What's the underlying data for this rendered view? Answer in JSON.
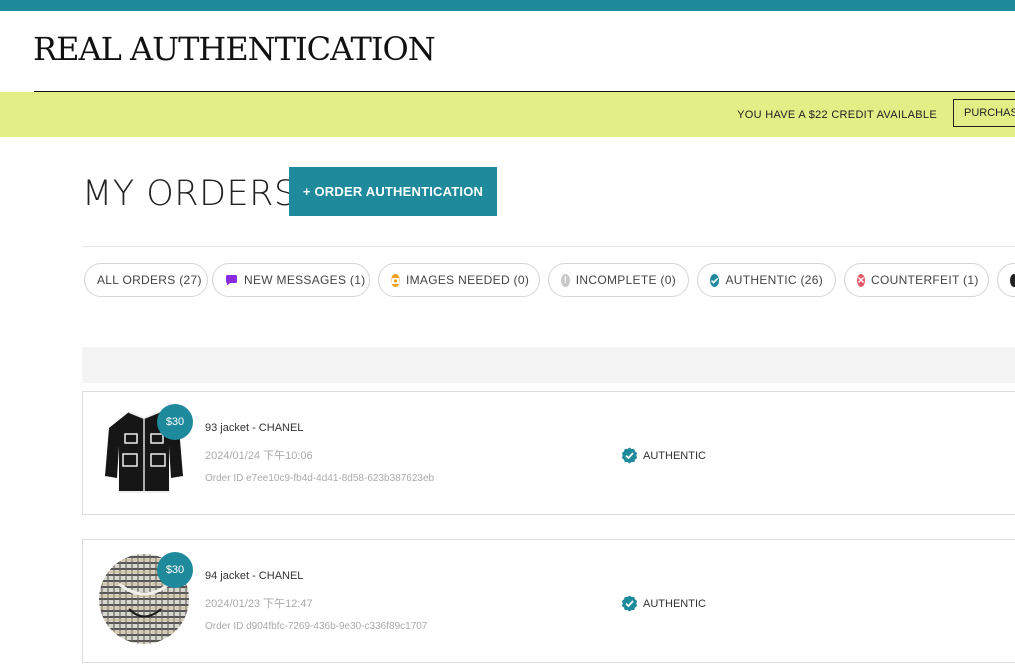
{
  "header": {
    "brand": "REAL AUTHENTICATION"
  },
  "credit": {
    "text": "YOU HAVE A $22 CREDIT AVAILABLE",
    "button_label": "PURCHASE"
  },
  "page": {
    "title": "MY ORDERS",
    "order_button_label": "+ ORDER AUTHENTICATION"
  },
  "filters": [
    {
      "label": "ALL ORDERS (27)",
      "icon": "none"
    },
    {
      "label": "NEW MESSAGES (1)",
      "icon": "chat-bubble-icon",
      "color": "#8a2be2"
    },
    {
      "label": "IMAGES NEEDED (0)",
      "icon": "camera-icon",
      "color": "#f0a020"
    },
    {
      "label": "INCOMPLETE (0)",
      "icon": "exclamation-icon",
      "color": "#c8c8c8"
    },
    {
      "label": "AUTHENTIC (26)",
      "icon": "verified-check-icon",
      "color": "#1f8a9c"
    },
    {
      "label": "COUNTERFEIT (1)",
      "icon": "x-circle-icon",
      "color": "#e05a6a"
    }
  ],
  "orders": [
    {
      "price": "$30",
      "name": "93 jacket - CHANEL",
      "date": "2024/01/24 下午10:06",
      "order_id": "Order ID e7ee10c9-fb4d-4d41-8d58-623b387623eb",
      "status": "AUTHENTIC"
    },
    {
      "price": "$30",
      "name": "94 jacket - CHANEL",
      "date": "2024/01/23 下午12:47",
      "order_id": "Order ID d904fbfc-7269-436b-9e30-c336f89c1707",
      "status": "AUTHENTIC"
    }
  ],
  "colors": {
    "accent": "#1f8a9c",
    "credit_bar": "#e3ee86"
  }
}
